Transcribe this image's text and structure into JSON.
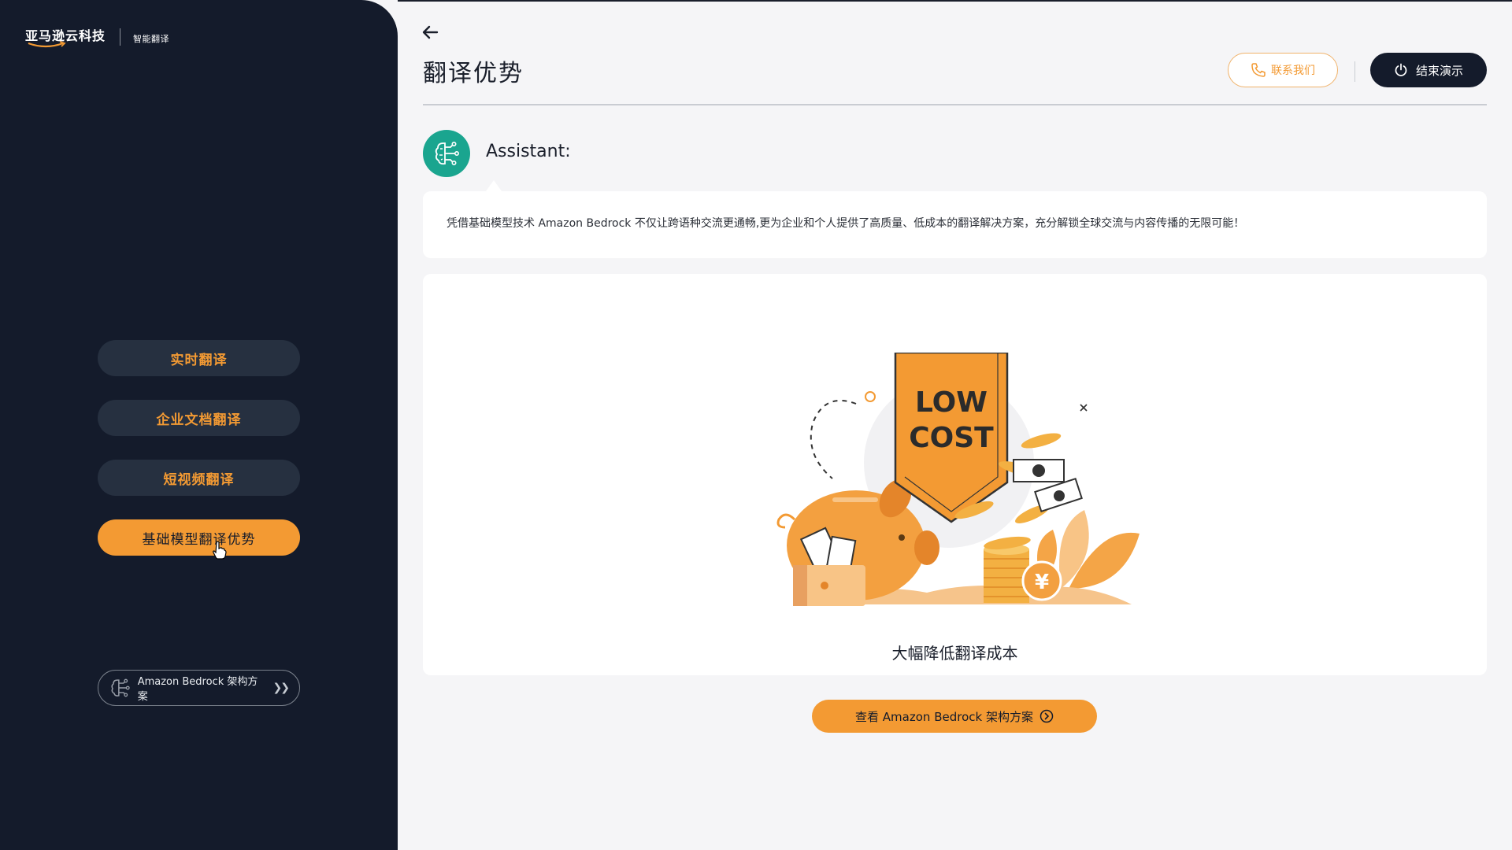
{
  "sidebar": {
    "logo_brand": "亚马逊云科技",
    "logo_sub": "智能翻译",
    "nav": [
      {
        "label": "实时翻译"
      },
      {
        "label": "企业文档翻译"
      },
      {
        "label": "短视频翻译"
      },
      {
        "label": "基础模型翻译优势"
      }
    ],
    "arch_button": "Amazon Bedrock 架构方案"
  },
  "header": {
    "title": "翻译优势",
    "contact_label": "联系我们",
    "end_label": "结束演示"
  },
  "assistant": {
    "label": "Assistant:",
    "message": "凭借基础模型技术 Amazon Bedrock 不仅让跨语种交流更通畅,更为企业和个人提供了高质量、低成本的翻译解决方案，充分解锁全球交流与内容传播的无限可能！"
  },
  "illustration": {
    "banner_line1": "LOW",
    "banner_line2": "COST",
    "currency_symbol": "¥",
    "caption": "大幅降低翻译成本"
  },
  "view_button": "查看 Amazon Bedrock 架构方案",
  "colors": {
    "accent": "#f39a33",
    "sidebar_bg": "#141b2b",
    "avatar_bg": "#1aa58f"
  }
}
